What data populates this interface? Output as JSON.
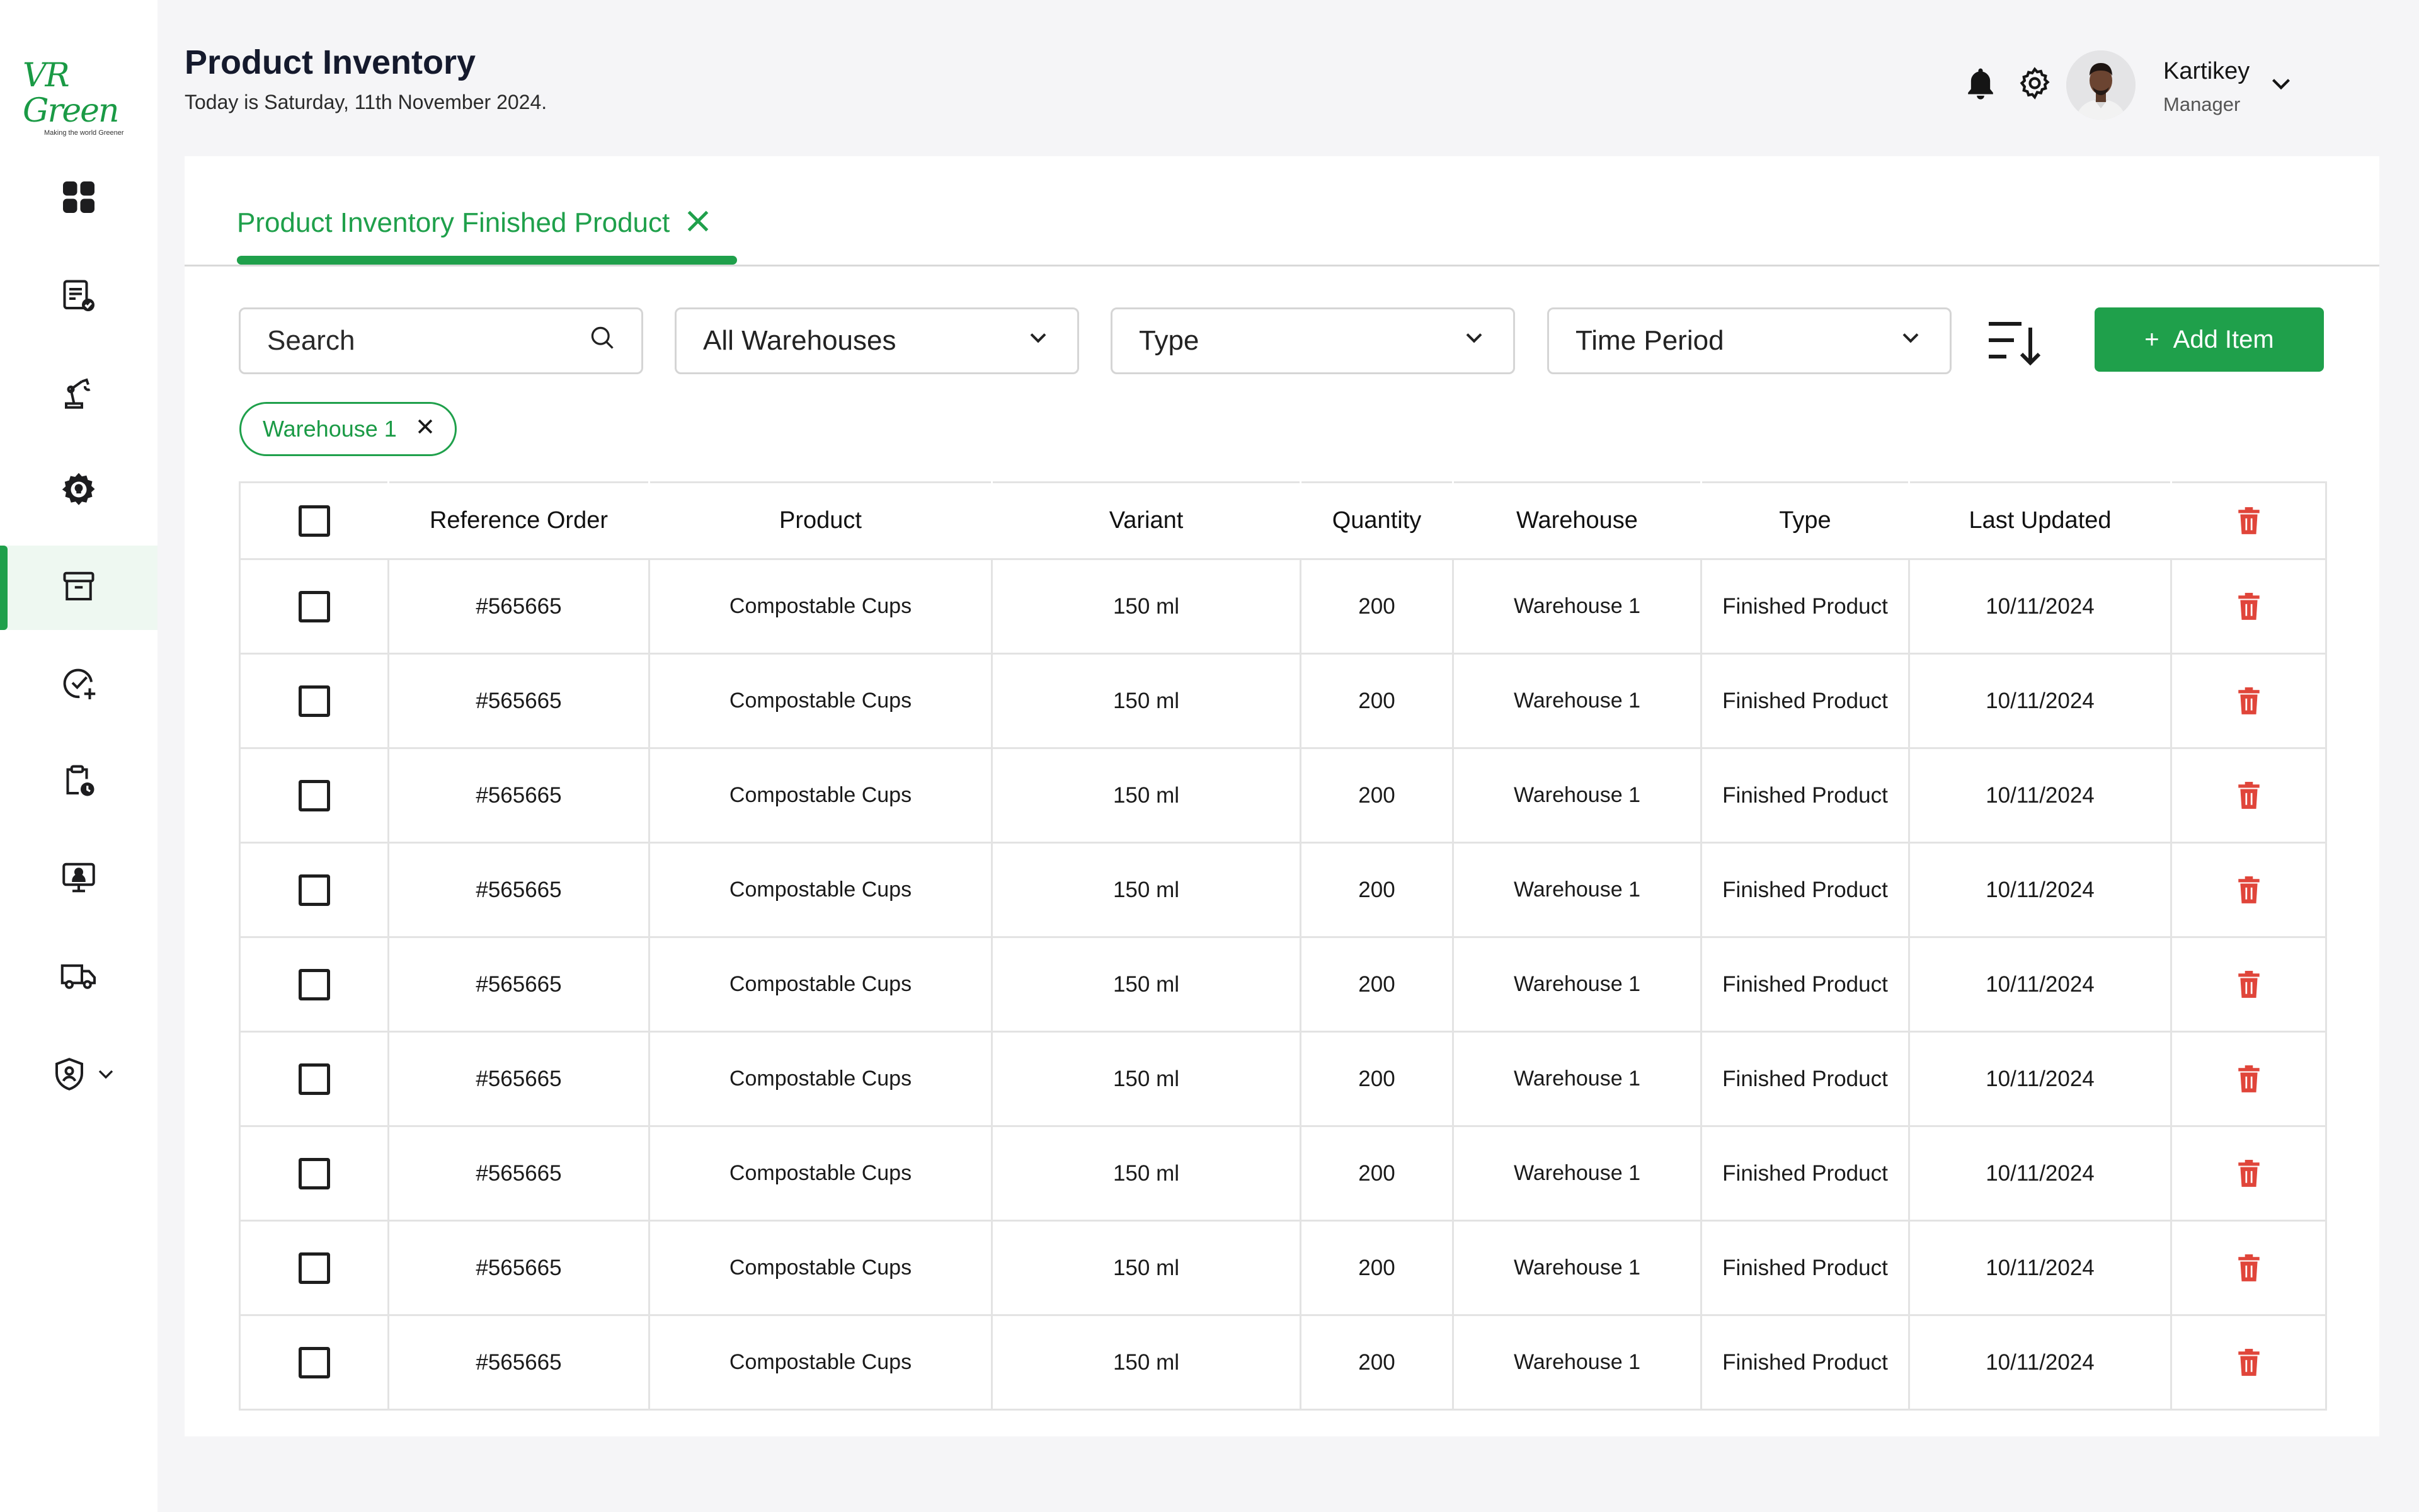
{
  "brand": {
    "logo_text": "VR Green",
    "tagline": "Making the world Greener"
  },
  "header": {
    "title": "Product Inventory",
    "subtitle": "Today is Saturday, 11th November 2024."
  },
  "user": {
    "name": "Kartikey",
    "role": "Manager"
  },
  "sidebar": {
    "items": [
      {
        "icon": "dashboard-icon"
      },
      {
        "icon": "orders-icon"
      },
      {
        "icon": "machinery-icon"
      },
      {
        "icon": "settings-gear-icon"
      },
      {
        "icon": "inventory-icon",
        "active": true
      },
      {
        "icon": "quality-check-icon"
      },
      {
        "icon": "schedule-icon"
      },
      {
        "icon": "employees-icon"
      },
      {
        "icon": "delivery-truck-icon"
      },
      {
        "icon": "security-shield-icon"
      }
    ]
  },
  "tab": {
    "label": "Product Inventory Finished Product"
  },
  "filters": {
    "search_placeholder": "Search",
    "warehouses": "All Warehouses",
    "type": "Type",
    "time_period": "Time Period"
  },
  "add_button": {
    "plus": "+",
    "label": "Add Item"
  },
  "active_chip": "Warehouse 1",
  "table": {
    "columns": [
      "Reference Order",
      "Product",
      "Variant",
      "Quantity",
      "Warehouse",
      "Type",
      "Last Updated"
    ],
    "rows": [
      {
        "ref": "#565665",
        "product": "Compostable Cups",
        "variant": "150 ml",
        "quantity": "200",
        "warehouse": "Warehouse 1",
        "type": "Finished Product",
        "updated": "10/11/2024"
      },
      {
        "ref": "#565665",
        "product": "Compostable Cups",
        "variant": "150 ml",
        "quantity": "200",
        "warehouse": "Warehouse 1",
        "type": "Finished Product",
        "updated": "10/11/2024"
      },
      {
        "ref": "#565665",
        "product": "Compostable Cups",
        "variant": "150 ml",
        "quantity": "200",
        "warehouse": "Warehouse 1",
        "type": "Finished Product",
        "updated": "10/11/2024"
      },
      {
        "ref": "#565665",
        "product": "Compostable Cups",
        "variant": "150 ml",
        "quantity": "200",
        "warehouse": "Warehouse 1",
        "type": "Finished Product",
        "updated": "10/11/2024"
      },
      {
        "ref": "#565665",
        "product": "Compostable Cups",
        "variant": "150 ml",
        "quantity": "200",
        "warehouse": "Warehouse 1",
        "type": "Finished Product",
        "updated": "10/11/2024"
      },
      {
        "ref": "#565665",
        "product": "Compostable Cups",
        "variant": "150 ml",
        "quantity": "200",
        "warehouse": "Warehouse 1",
        "type": "Finished Product",
        "updated": "10/11/2024"
      },
      {
        "ref": "#565665",
        "product": "Compostable Cups",
        "variant": "150 ml",
        "quantity": "200",
        "warehouse": "Warehouse 1",
        "type": "Finished Product",
        "updated": "10/11/2024"
      },
      {
        "ref": "#565665",
        "product": "Compostable Cups",
        "variant": "150 ml",
        "quantity": "200",
        "warehouse": "Warehouse 1",
        "type": "Finished Product",
        "updated": "10/11/2024"
      },
      {
        "ref": "#565665",
        "product": "Compostable Cups",
        "variant": "150 ml",
        "quantity": "200",
        "warehouse": "Warehouse 1",
        "type": "Finished Product",
        "updated": "10/11/2024"
      }
    ]
  },
  "colors": {
    "accent": "#1fa04b",
    "delete": "#e0453a",
    "background": "#f5f5f7"
  }
}
